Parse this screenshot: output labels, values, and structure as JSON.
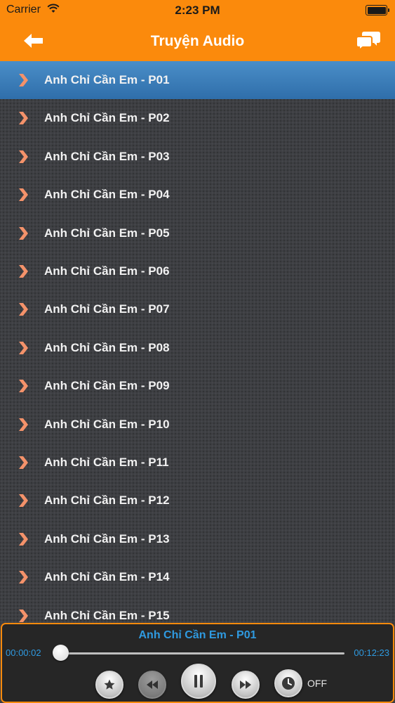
{
  "status_bar": {
    "carrier": "Carrier",
    "time": "2:23 PM"
  },
  "nav": {
    "title": "Truyện Audio",
    "left_icon": "back-arrow-icon",
    "right_icon": "chat-bubbles-icon"
  },
  "episodes": {
    "selected_index": 0,
    "items": [
      "Anh Chỉ Cần Em - P01",
      "Anh Chỉ Cần Em - P02",
      "Anh Chỉ Cần Em - P03",
      "Anh Chỉ Cần Em - P04",
      "Anh Chỉ Cần Em - P05",
      "Anh Chỉ Cần Em - P06",
      "Anh Chỉ Cần Em - P07",
      "Anh Chỉ Cần Em - P08",
      "Anh Chỉ Cần Em - P09",
      "Anh Chỉ Cần Em - P10",
      "Anh Chỉ Cần Em - P11",
      "Anh Chỉ Cần Em - P12",
      "Anh Chỉ Cần Em - P13",
      "Anh Chỉ Cần Em - P14",
      "Anh Chỉ Cần Em - P15"
    ]
  },
  "player": {
    "now_playing": "Anh Chỉ Cần Em - P01",
    "elapsed": "00:00:02",
    "duration": "00:12:23",
    "progress_fraction": 0.003,
    "timer_label": "OFF"
  },
  "colors": {
    "accent": "#fb8a0c",
    "selected_row": "#3a7ebb",
    "player_text": "#2f9ae0",
    "chevron": "#f4926a"
  }
}
